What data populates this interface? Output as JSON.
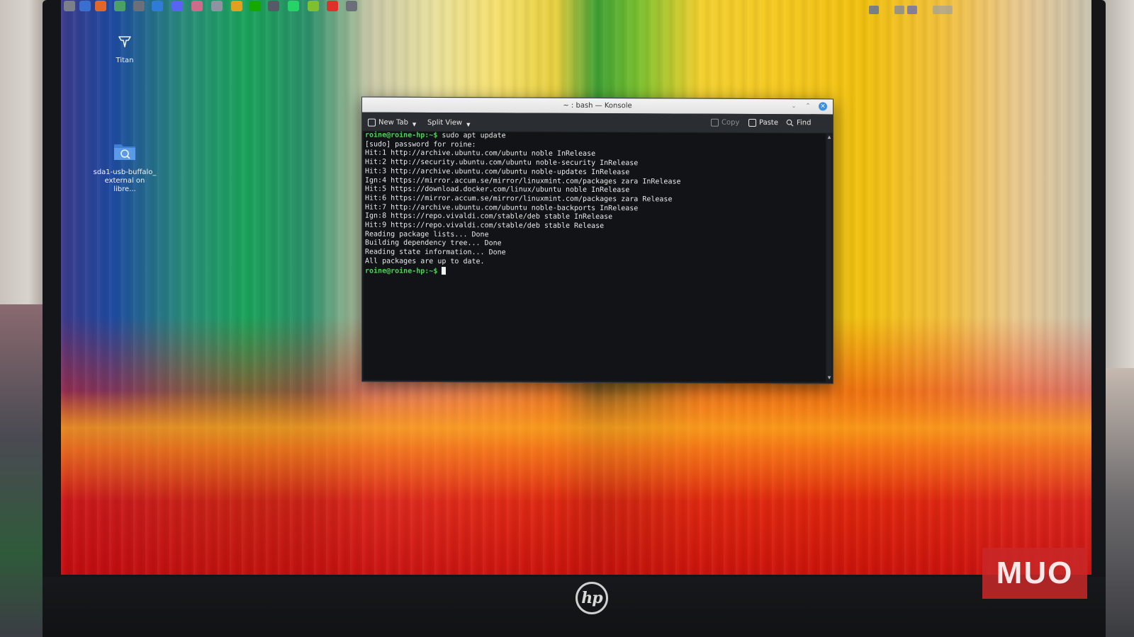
{
  "desktop": {
    "icons": [
      {
        "label": "Titan"
      },
      {
        "label": "sda1-usb-buffalo_ external on libre..."
      }
    ]
  },
  "taskbar": {
    "launchers": [
      {
        "icon": "instagram-icon",
        "color": "#7a7f8a"
      },
      {
        "icon": "window-icon",
        "color": "#3a6fd0"
      },
      {
        "icon": "firefox-icon",
        "color": "#e0662a"
      },
      {
        "icon": "files-icon",
        "color": "#4aa066"
      },
      {
        "icon": "terminal-icon",
        "color": "#6a6f7a"
      },
      {
        "icon": "folder-icon",
        "color": "#2f7bd8"
      },
      {
        "icon": "discord-icon",
        "color": "#5865f2"
      },
      {
        "icon": "browser-icon",
        "color": "#d06a8a"
      },
      {
        "icon": "document-icon",
        "color": "#8d93a0"
      },
      {
        "icon": "chrome-icon",
        "color": "#e0a020"
      },
      {
        "icon": "upwork-icon",
        "color": "#14a800"
      },
      {
        "icon": "app-icon",
        "color": "#555a66"
      },
      {
        "icon": "whatsapp-icon",
        "color": "#25d366"
      },
      {
        "icon": "spotify-icon",
        "color": "#7fc030"
      },
      {
        "icon": "vivaldi-icon",
        "color": "#e0302a"
      },
      {
        "icon": "terminal-icon",
        "color": "#6a6f7a"
      }
    ]
  },
  "konsole": {
    "title": "~ : bash — Konsole",
    "toolbar": {
      "new_tab": "New Tab",
      "split_view": "Split View",
      "copy": "Copy",
      "paste": "Paste",
      "find": "Find"
    },
    "lines": [
      {
        "prompt": "roine@roine-hp:~$",
        "text": " sudo apt update"
      },
      {
        "prompt": "",
        "text": "[sudo] password for roine:"
      },
      {
        "prompt": "",
        "text": "Hit:1 http://archive.ubuntu.com/ubuntu noble InRelease"
      },
      {
        "prompt": "",
        "text": "Hit:2 http://security.ubuntu.com/ubuntu noble-security InRelease"
      },
      {
        "prompt": "",
        "text": "Hit:3 http://archive.ubuntu.com/ubuntu noble-updates InRelease"
      },
      {
        "prompt": "",
        "text": "Ign:4 https://mirror.accum.se/mirror/linuxmint.com/packages zara InRelease"
      },
      {
        "prompt": "",
        "text": "Hit:5 https://download.docker.com/linux/ubuntu noble InRelease"
      },
      {
        "prompt": "",
        "text": "Hit:6 https://mirror.accum.se/mirror/linuxmint.com/packages zara Release"
      },
      {
        "prompt": "",
        "text": "Hit:7 http://archive.ubuntu.com/ubuntu noble-backports InRelease"
      },
      {
        "prompt": "",
        "text": "Ign:8 https://repo.vivaldi.com/stable/deb stable InRelease"
      },
      {
        "prompt": "",
        "text": "Hit:9 https://repo.vivaldi.com/stable/deb stable Release"
      },
      {
        "prompt": "",
        "text": "Reading package lists... Done"
      },
      {
        "prompt": "",
        "text": "Building dependency tree... Done"
      },
      {
        "prompt": "",
        "text": "Reading state information... Done"
      },
      {
        "prompt": "",
        "text": "All packages are up to date."
      },
      {
        "prompt": "roine@roine-hp:~$",
        "text": " "
      }
    ]
  },
  "laptop": {
    "brand": "hp"
  },
  "watermark": {
    "text": "MUO"
  },
  "colors": {
    "prompt": "#4fd05a",
    "terminal_bg": "#121317",
    "close_button": "#3d8fe0",
    "watermark": "#c82828"
  }
}
